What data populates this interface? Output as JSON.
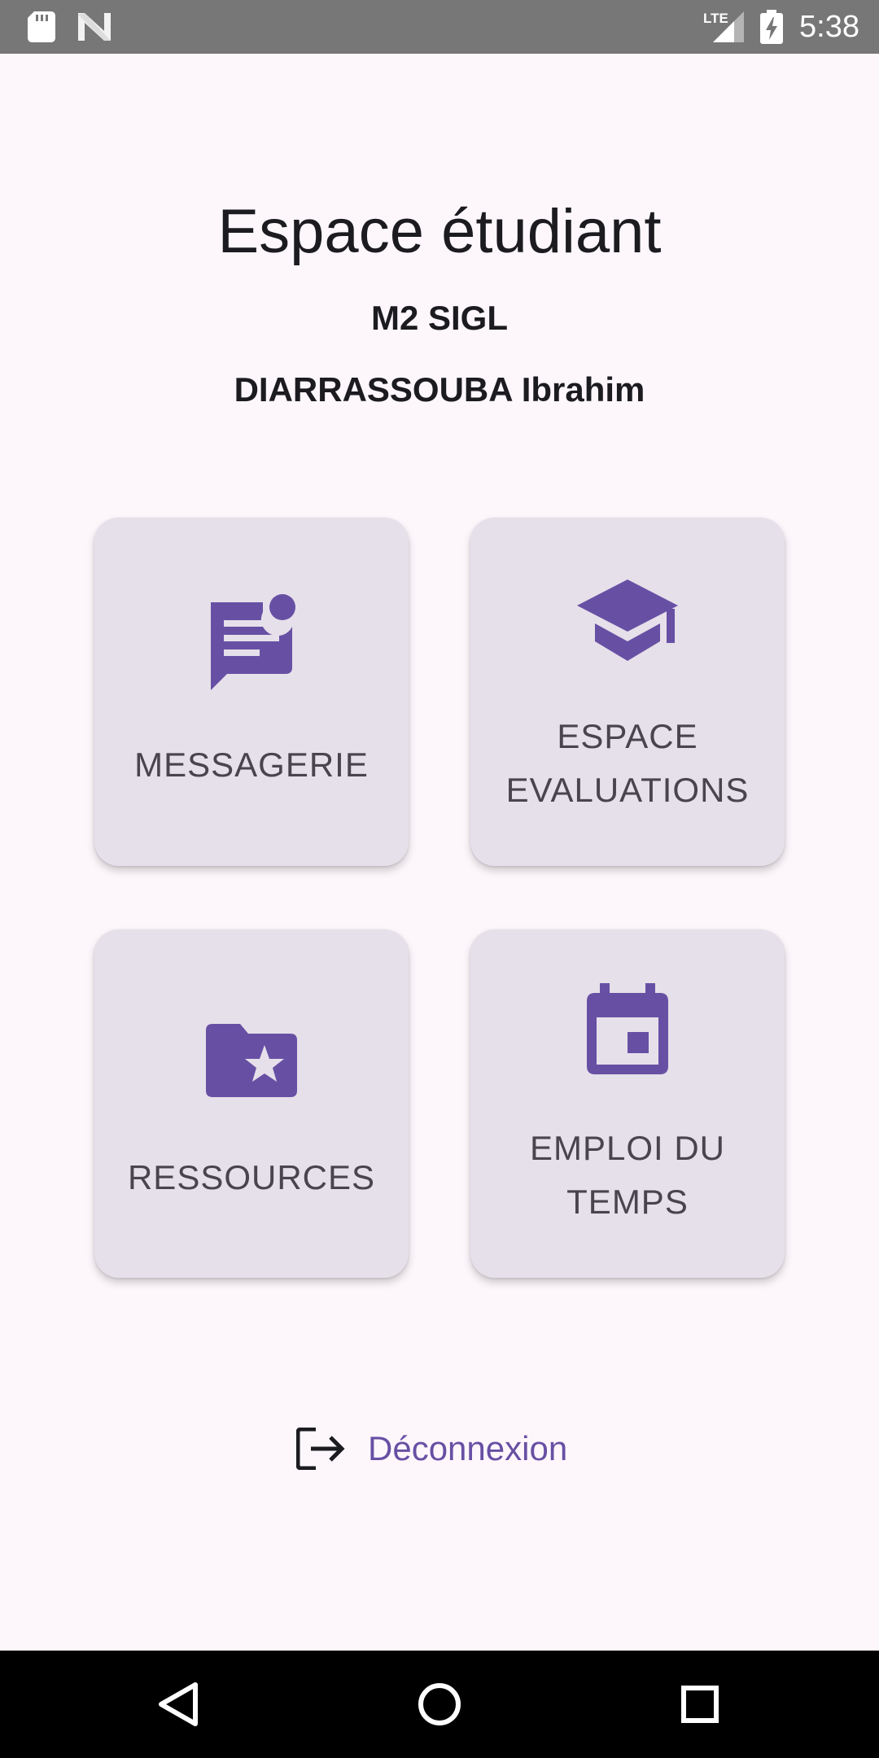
{
  "status_bar": {
    "time": "5:38",
    "network": "LTE",
    "icons": [
      "sd-card-icon",
      "n-logo-icon",
      "lte-signal-icon",
      "battery-charging-icon"
    ]
  },
  "header": {
    "title": "Espace étudiant",
    "program": "M2 SIGL",
    "student_name": "DIARRASSOUBA Ibrahim"
  },
  "cards": [
    {
      "label": "MESSAGERIE",
      "icon": "message-notification-icon"
    },
    {
      "label_line1": "ESPACE",
      "label_line2": "EVALUATIONS",
      "icon": "graduation-cap-icon"
    },
    {
      "label": "RESSOURCES",
      "icon": "folder-star-icon"
    },
    {
      "label_line1": "EMPLOI DU",
      "label_line2": "TEMPS",
      "icon": "calendar-icon"
    }
  ],
  "logout": {
    "label": "Déconnexion",
    "icon": "logout-icon"
  },
  "nav_bar": {
    "buttons": [
      "back-icon",
      "home-icon",
      "recents-icon"
    ]
  },
  "colors": {
    "accent": "#6750a4",
    "card_bg": "#e6e0ea",
    "background": "#fdf7fc",
    "text": "#1c1b1f",
    "label_text": "#49454f"
  }
}
